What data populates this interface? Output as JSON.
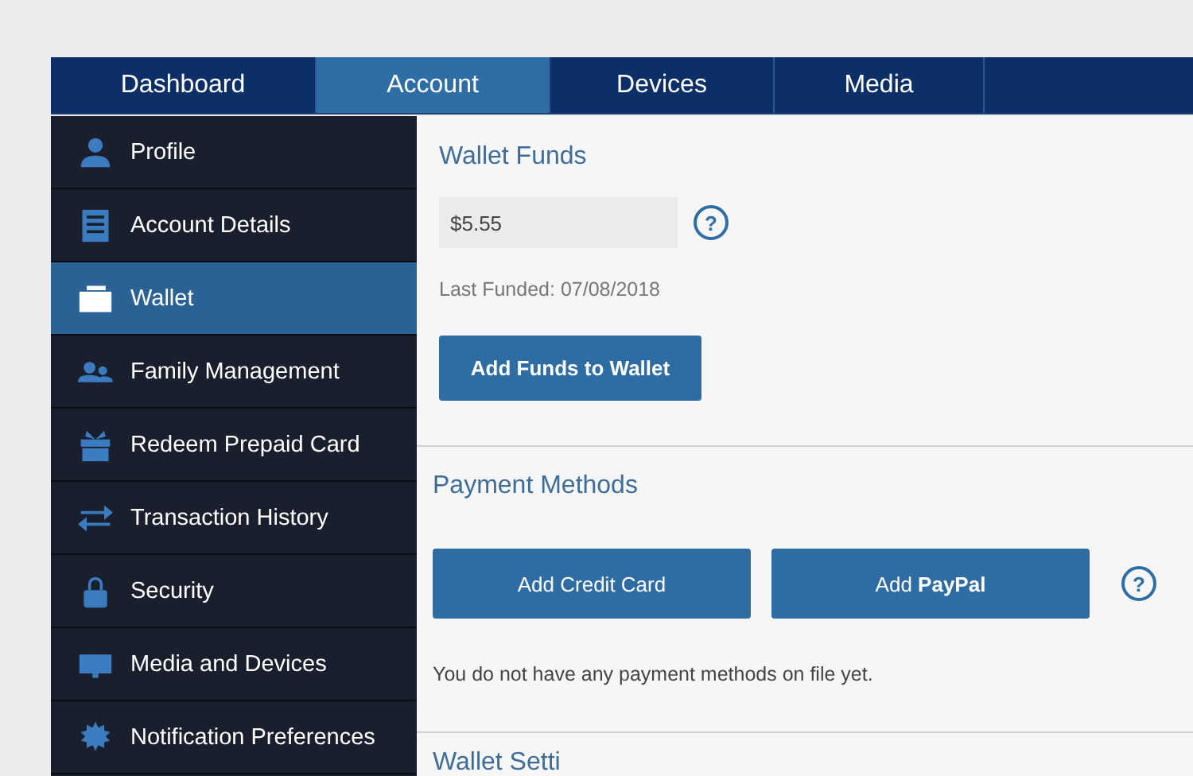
{
  "tabs": [
    {
      "label": "Dashboard",
      "selected": false
    },
    {
      "label": "Account",
      "selected": true
    },
    {
      "label": "Devices",
      "selected": false
    },
    {
      "label": "Media",
      "selected": false
    }
  ],
  "sidebar": {
    "items": [
      {
        "label": "Profile",
        "selected": false
      },
      {
        "label": "Account Details",
        "selected": false
      },
      {
        "label": "Wallet",
        "selected": true
      },
      {
        "label": "Family Management",
        "selected": false
      },
      {
        "label": "Redeem Prepaid Card",
        "selected": false
      },
      {
        "label": "Transaction History",
        "selected": false
      },
      {
        "label": "Security",
        "selected": false
      },
      {
        "label": "Media and Devices",
        "selected": false
      },
      {
        "label": "Notification Preferences",
        "selected": false
      }
    ]
  },
  "wallet_funds": {
    "title": "Wallet Funds",
    "balance": "$5.55",
    "help": "?",
    "last_funded": "Last Funded: 07/08/2018",
    "button": "Add Funds to Wallet"
  },
  "payment_methods": {
    "title": "Payment Methods",
    "buttons": [
      "Add Credit Card",
      "Add **PayPal**"
    ],
    "help": "?",
    "message": "You do not have any payment methods on file yet."
  },
  "wallet_settings": {
    "title": "Wallet Setti"
  }
}
